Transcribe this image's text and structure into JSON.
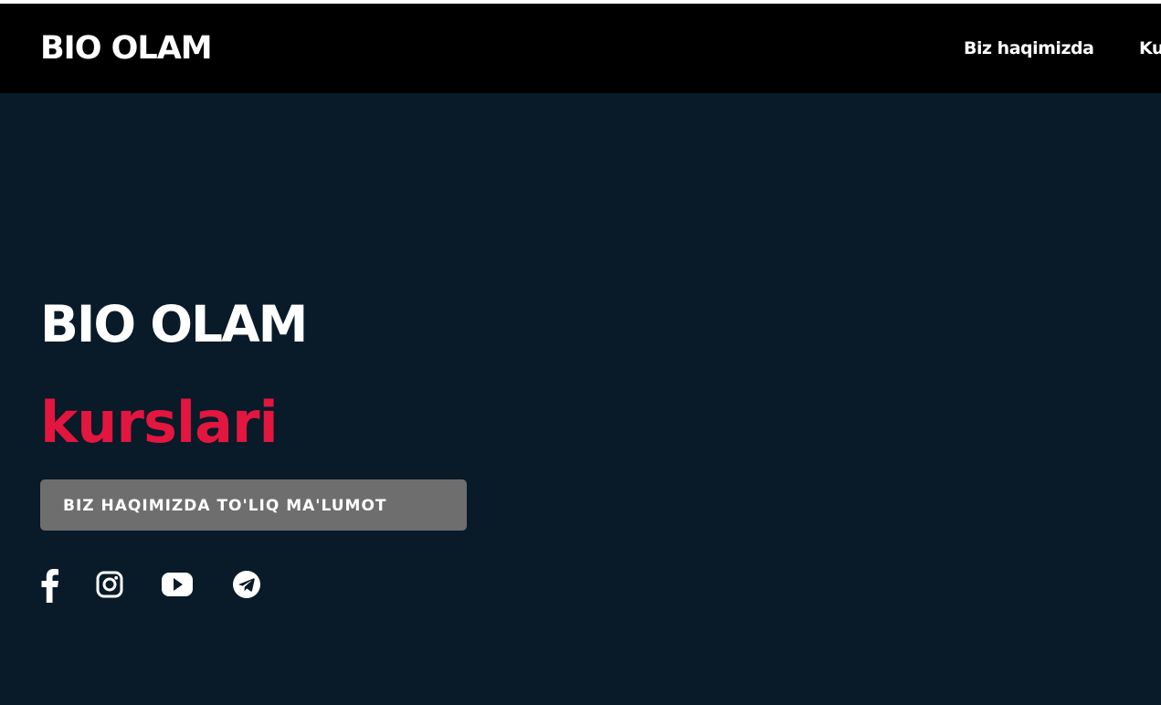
{
  "navbar": {
    "brand": "BIO OLAM",
    "links": [
      {
        "label": "Biz haqimizda"
      },
      {
        "label": "Ku"
      }
    ]
  },
  "hero": {
    "title": "BIO OLAM",
    "subtitle": "kurslari",
    "cta_label": "BIZ HAQIMIZDA TO'LIQ MA'LUMOT"
  },
  "social": [
    {
      "icon": "facebook-icon"
    },
    {
      "icon": "instagram-icon"
    },
    {
      "icon": "youtube-icon"
    },
    {
      "icon": "telegram-icon"
    }
  ],
  "colors": {
    "navbar_bg": "#000000",
    "hero_bg": "#091a28",
    "accent": "#e2163f",
    "button_bg": "#6e6e6e",
    "text": "#ffffff"
  }
}
